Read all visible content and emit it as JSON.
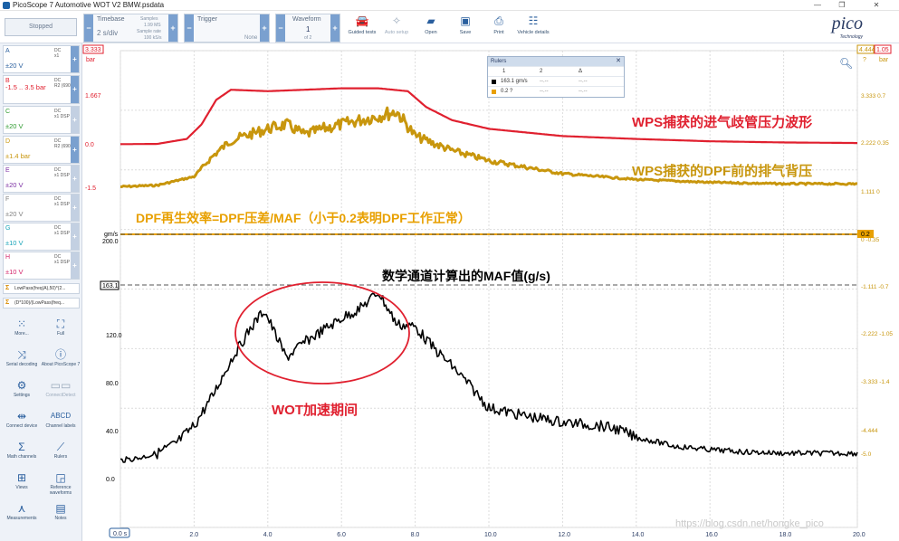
{
  "window": {
    "title": "PicoScope 7 Automotive WOT V2 BMW.psdata",
    "controls": [
      "—",
      "❐",
      "✕"
    ]
  },
  "toolbar": {
    "run_label": "Stopped",
    "timebase": {
      "label": "Timebase",
      "value": "2 s/div",
      "samples_label": "Samples",
      "samples_value": "1.99 MS",
      "rate_label": "Sample rate",
      "rate_value": "100 kS/s"
    },
    "trigger": {
      "label": "Trigger",
      "mode": "None"
    },
    "waveform": {
      "label": "Waveform",
      "value": "1",
      "of": "of 2"
    },
    "buttons": [
      {
        "label": "Guided tests",
        "icon": "car-icon",
        "enabled": true
      },
      {
        "label": "Auto setup",
        "icon": "wand-icon",
        "enabled": false
      },
      {
        "label": "Open",
        "icon": "folder-icon",
        "enabled": true
      },
      {
        "label": "Save",
        "icon": "save-icon",
        "enabled": true
      },
      {
        "label": "Print",
        "icon": "printer-icon",
        "enabled": true
      },
      {
        "label": "Vehicle details",
        "icon": "clipboard-icon",
        "enabled": true
      }
    ],
    "logo": "pico",
    "logo_sub": "Technology"
  },
  "channels": [
    {
      "letter": "A",
      "range": "±20 V",
      "coupling": "DC",
      "probe": "x1",
      "color": "#2a5f9e",
      "active": true
    },
    {
      "letter": "B",
      "range": "-1.5 .. 3.5 bar",
      "coupling": "DC",
      "probe": "R2 (690",
      "color": "#e0202f",
      "active": true
    },
    {
      "letter": "C",
      "range": "±20 V",
      "coupling": "DC",
      "probe": "x1 DSP",
      "color": "#2f9b30",
      "active": false
    },
    {
      "letter": "D",
      "range": "±1.4 bar",
      "coupling": "DC",
      "probe": "R2 (690",
      "color": "#c8960d",
      "active": false
    },
    {
      "letter": "E",
      "range": "±20 V",
      "coupling": "DC",
      "probe": "x1 DSP",
      "color": "#7b2fa3",
      "active": false
    },
    {
      "letter": "F",
      "range": "±20 V",
      "coupling": "DC",
      "probe": "x1 DSP",
      "color": "#808080",
      "active": false
    },
    {
      "letter": "G",
      "range": "±10 V",
      "coupling": "DC",
      "probe": "x1 DSP",
      "color": "#17a3b8",
      "active": false
    },
    {
      "letter": "H",
      "range": "±10 V",
      "coupling": "DC",
      "probe": "x1 DSP",
      "color": "#d4246a",
      "active": false
    }
  ],
  "math_channels": [
    "LowPass(freq(A),50)*(2...",
    "(D*100)/(LowPass(freq..."
  ],
  "left_buttons": [
    {
      "label": "More...",
      "icon": "grid-icon",
      "enabled": true
    },
    {
      "label": "Full",
      "icon": "fullscreen-icon",
      "enabled": true
    },
    {
      "label": "Serial decoding",
      "icon": "serial-icon",
      "enabled": true
    },
    {
      "label": "About PicoScope 7",
      "icon": "info-icon",
      "enabled": true
    },
    {
      "label": "Settings",
      "icon": "gear-icon",
      "enabled": true
    },
    {
      "label": "ConnectDetect",
      "icon": "connect-detect-icon",
      "enabled": false
    },
    {
      "label": "Connect device",
      "icon": "usb-icon",
      "enabled": true
    },
    {
      "label": "Channel labels",
      "icon": "abcd-icon",
      "enabled": true
    },
    {
      "label": "Math channels",
      "icon": "sigma-icon",
      "enabled": true
    },
    {
      "label": "Rulers",
      "icon": "ruler-icon",
      "enabled": true
    },
    {
      "label": "Views",
      "icon": "views-icon",
      "enabled": true
    },
    {
      "label": "Reference waveforms",
      "icon": "reference-icon",
      "enabled": true
    },
    {
      "label": "Measurements",
      "icon": "measure-icon",
      "enabled": true
    },
    {
      "label": "Notes",
      "icon": "notes-icon",
      "enabled": true
    }
  ],
  "rulers_panel": {
    "title": "Rulers",
    "headers": [
      "1",
      "2",
      "Δ"
    ],
    "rows": [
      {
        "color": "#000000",
        "v1": "163.1 gm/s",
        "v2": "--.--",
        "delta": "--.--"
      },
      {
        "color": "#e8a000",
        "v1": "0.2 ?",
        "v2": "--.--",
        "delta": "--.--"
      }
    ]
  },
  "annotations": {
    "wps_intake": "WPS捕获的进气歧管压力波形",
    "wps_exhaust": "WPS捕获的DPF前的排气背压",
    "dpf_efficiency": "DPF再生效率=DPF压差/MAF（小于0.2表明DPF工作正常）",
    "maf_label": "数学通道计算出的MAF值(g/s)",
    "wot_label": "WOT加速期间"
  },
  "axes": {
    "top_axis_red": [
      "1.667",
      "0.0",
      "-1.5"
    ],
    "top_badge_red": "3.333",
    "top_unit_red": "bar",
    "right_gold_top": "4.444",
    "right_red_top": "1.05",
    "right_units": [
      "?",
      "bar"
    ],
    "right_values": [
      "3.333 0.7",
      "2.222 0.35",
      "1.111 0",
      "0 -0.35",
      "-1.111 -0.7",
      "-2.222 -1.05",
      "-3.333 -1.4",
      "-4.444",
      "-5.0"
    ],
    "maf_unit": "gm/s",
    "maf_top": "200.0",
    "maf_ruler_badge": "163.1",
    "maf_ticks": [
      "120.0",
      "80.0",
      "40.0",
      "0.0"
    ],
    "efficiency_badge": "0.2",
    "x_ticks": [
      "0.0 s",
      "2.0",
      "4.0",
      "6.0",
      "8.0",
      "10.0",
      "12.0",
      "14.0",
      "16.0",
      "18.0",
      "20.0"
    ]
  },
  "watermark": "https://blog.csdn.net/hongke_pico",
  "chart_data": {
    "type": "line",
    "x_unit": "s",
    "xlim": [
      0,
      20
    ],
    "series": [
      {
        "color": "#e0202f",
        "x": [
          0,
          1,
          1.8,
          2.2,
          2.6,
          3,
          4,
          5,
          6,
          7,
          7.8,
          8.3,
          9,
          10,
          12,
          14,
          16,
          18,
          20
        ],
        "y": [
          0.02,
          0.03,
          0.2,
          0.7,
          1.55,
          1.9,
          1.85,
          1.9,
          1.95,
          1.95,
          1.85,
          1.3,
          0.85,
          0.55,
          0.3,
          0.2,
          0.12,
          0.08,
          0.06
        ]
      },
      {
        "color": "#c8960d",
        "x": [
          0,
          1,
          2,
          2.5,
          3,
          3.5,
          4,
          4.5,
          5,
          5.5,
          6,
          7,
          7.5,
          8,
          9,
          10,
          12,
          14,
          16,
          18,
          20
        ],
        "y": [
          -1.45,
          -1.4,
          -1.1,
          -0.4,
          0.15,
          0.35,
          0.55,
          0.7,
          0.35,
          0.55,
          0.7,
          1.0,
          1.15,
          0.3,
          -0.2,
          -0.55,
          -1.0,
          -1.2,
          -1.3,
          -1.35,
          -1.35
        ]
      },
      {
        "color": "#e8a000",
        "x": [
          0,
          20
        ],
        "y": [
          0.0,
          0.0
        ]
      },
      {
        "color": "#000000",
        "x": [
          0,
          0.5,
          1,
          1.5,
          2,
          2.5,
          3,
          3.5,
          3.9,
          4.5,
          5,
          5.5,
          6,
          6.5,
          7,
          7.5,
          8,
          8.5,
          9,
          9.5,
          10,
          11,
          12,
          13,
          13.5,
          14,
          14.5,
          15,
          16,
          17,
          18,
          19,
          20
        ],
        "y": [
          16,
          18,
          22,
          30,
          45,
          70,
          100,
          125,
          142,
          102,
          115,
          125,
          135,
          143,
          157,
          130,
          128,
          110,
          95,
          78,
          60,
          53,
          48,
          45,
          42,
          35,
          32,
          28,
          25,
          23,
          22,
          22,
          22
        ]
      }
    ]
  }
}
